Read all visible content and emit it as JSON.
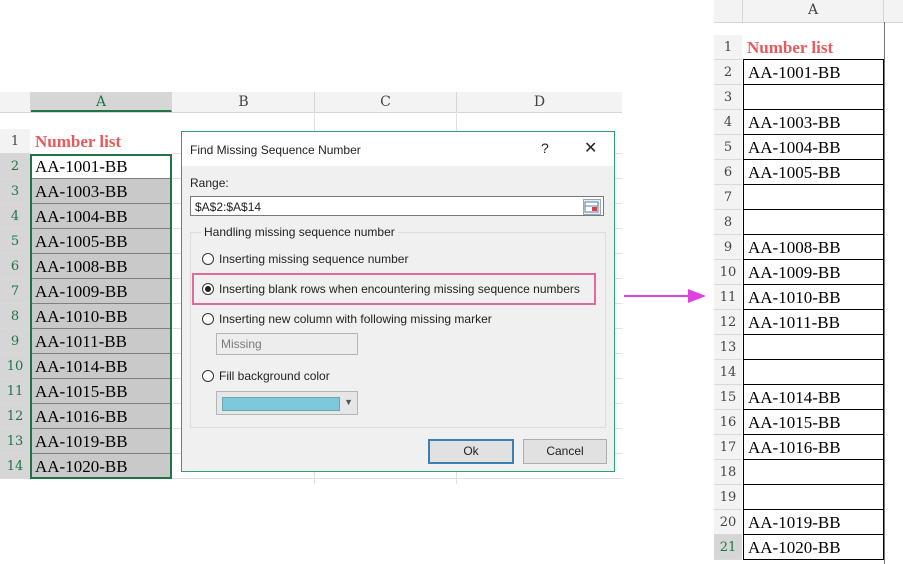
{
  "left_sheet": {
    "columns": [
      "A",
      "B",
      "C",
      "D"
    ],
    "row_numbers": [
      "1",
      "2",
      "3",
      "4",
      "5",
      "6",
      "7",
      "8",
      "9",
      "10",
      "11",
      "12",
      "13",
      "14"
    ],
    "header_cell": "Number list",
    "values": [
      "AA-1001-BB",
      "AA-1003-BB",
      "AA-1004-BB",
      "AA-1005-BB",
      "AA-1008-BB",
      "AA-1009-BB",
      "AA-1010-BB",
      "AA-1011-BB",
      "AA-1014-BB",
      "AA-1015-BB",
      "AA-1016-BB",
      "AA-1019-BB",
      "AA-1020-BB"
    ]
  },
  "dialog": {
    "title": "Find Missing Sequence Number",
    "help": "?",
    "close": "✕",
    "range_label": "Range:",
    "range_value": "$A$2:$A$14",
    "group_title": "Handling missing sequence number",
    "options": [
      "Inserting missing sequence number",
      "Inserting blank rows when encountering missing sequence numbers",
      "Inserting new column with following missing marker",
      "Fill background color"
    ],
    "selected_option": 1,
    "marker_placeholder": "Missing",
    "fill_color": "#7ec8de",
    "ok": "Ok",
    "cancel": "Cancel"
  },
  "right_sheet": {
    "column": "A",
    "header_cell": "Number list",
    "rows": [
      {
        "n": "1",
        "v": "Number list"
      },
      {
        "n": "2",
        "v": "AA-1001-BB"
      },
      {
        "n": "3",
        "v": ""
      },
      {
        "n": "4",
        "v": "AA-1003-BB"
      },
      {
        "n": "5",
        "v": "AA-1004-BB"
      },
      {
        "n": "6",
        "v": "AA-1005-BB"
      },
      {
        "n": "7",
        "v": ""
      },
      {
        "n": "8",
        "v": ""
      },
      {
        "n": "9",
        "v": "AA-1008-BB"
      },
      {
        "n": "10",
        "v": "AA-1009-BB"
      },
      {
        "n": "11",
        "v": "AA-1010-BB"
      },
      {
        "n": "12",
        "v": "AA-1011-BB"
      },
      {
        "n": "13",
        "v": ""
      },
      {
        "n": "14",
        "v": ""
      },
      {
        "n": "15",
        "v": "AA-1014-BB"
      },
      {
        "n": "16",
        "v": "AA-1015-BB"
      },
      {
        "n": "17",
        "v": "AA-1016-BB"
      },
      {
        "n": "18",
        "v": ""
      },
      {
        "n": "19",
        "v": ""
      },
      {
        "n": "20",
        "v": "AA-1019-BB"
      },
      {
        "n": "21",
        "v": "AA-1020-BB"
      }
    ]
  },
  "colors": {
    "header_red": "#e8595b",
    "selection_green": "#217346",
    "arrow_magenta": "#e040e0",
    "highlight_pink": "#e06a9a"
  }
}
